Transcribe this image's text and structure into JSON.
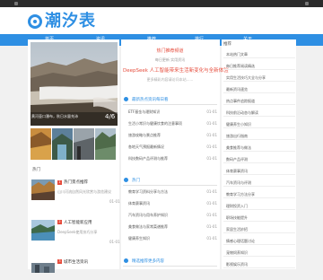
{
  "site": {
    "logo_text": "潮汐表",
    "brand_color": "#2e8fe3",
    "accent_color": "#e64c3c"
  },
  "nav": [
    "首页",
    "资讯",
    "推荐",
    "排行",
    "关于"
  ],
  "hero": {
    "caption": "黄河壶口瀑布，秋日水量充沛",
    "count": "4/6"
  },
  "promo": {
    "title": "热门推荐频道",
    "subtitle": "每日更新 实用资讯",
    "headline": "DeepSeek 人工智能带来生活新变化与全新体验",
    "note": "更多精彩内容请访问本站......"
  },
  "section1": {
    "title": "最新热点资讯每日看",
    "rows": [
      {
        "text": "ETF基金与理财知识",
        "date": "01-01"
      },
      {
        "text": "生活小常识与健康饮食的注意事项",
        "date": "01-01"
      },
      {
        "text": "旅游攻略与景点推荐",
        "date": "01-01"
      },
      {
        "text": "各地天气预报最新情况",
        "date": "01-01"
      },
      {
        "text": "科技数码产品评测与推荐",
        "date": "01-01"
      }
    ]
  },
  "section2": {
    "title": "热门",
    "rows": [
      {
        "text": "教育学习资料分享与方法",
        "date": "01-01"
      },
      {
        "text": "体育赛事资讯",
        "date": "01-01"
      },
      {
        "text": "汽车资讯与用车养护知识",
        "date": "01-01"
      },
      {
        "text": "美食做法与家常菜谱推荐",
        "date": "01-01"
      },
      {
        "text": "健康养生知识",
        "date": "01-01"
      }
    ]
  },
  "section3": {
    "title": "精选推荐更多内容"
  },
  "sidebar": {
    "title": "推荐",
    "items": [
      "本站热门文章",
      "每日推荐阅读精选",
      "实用生活技巧大全与分享",
      "最新资讯速览",
      "热点事件追踪报道",
      "科技前沿动态与解读",
      "健康养生小知识",
      "旅游出行指南",
      "美食推荐与做法",
      "数码产品评测",
      "体育赛事资讯",
      "汽车资讯与评测",
      "教育学习方法分享",
      "理财投资入门",
      "职场技能提升",
      "家居生活妙招",
      "情感心理话题讨论",
      "宠物饲养知识",
      "影视娱乐资讯",
      "游戏攻略"
    ]
  },
  "hot": {
    "title": "热门",
    "items": [
      {
        "num": "1",
        "title": "热门景点推荐",
        "sub": "山川河流自然风光欣赏与游览建议",
        "date": "01-01"
      },
      {
        "num": "2",
        "title": "人工智能新应用",
        "sub": "DeepSeek使用技巧分享",
        "date": "01-01"
      },
      {
        "num": "3",
        "title": "城市生活资讯",
        "sub": "",
        "date": ""
      }
    ]
  }
}
